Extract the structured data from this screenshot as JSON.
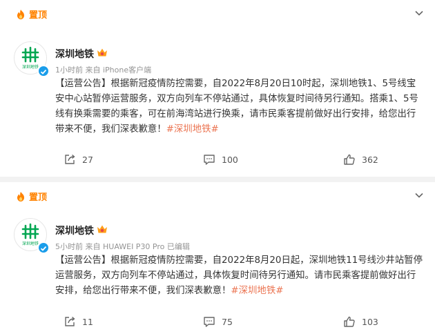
{
  "colors": {
    "accent": "#ff8200",
    "hashtag": "#eb7350",
    "verified": "#1a9dea",
    "logo": "#00a651"
  },
  "posts": [
    {
      "pin_label": "置顶",
      "author": "深圳地铁",
      "avatar_text": "深圳地铁",
      "meta": "1小时前 来自 iPhone客户端",
      "text": "【运营公告】根据新冠疫情防控需要，自2022年8月20日10时起，深圳地铁1、5号线宝安中心站暂停运营服务，双方向列车不停站通过，具体恢复时间待另行通知。搭乘1、5号线有换乘需要的乘客，可在前海湾站进行换乘，请市民乘客提前做好出行安排，给您出行带来不便，我们深表歉意！",
      "hashtag": "#深圳地铁#",
      "reposts": "27",
      "comments": "100",
      "likes": "362"
    },
    {
      "pin_label": "置顶",
      "author": "深圳地铁",
      "avatar_text": "深圳地铁",
      "meta": "5小时前 来自 HUAWEI P30 Pro 已编辑",
      "text": "【运营公告】根据新冠疫情防控需要，自2022年8月20日起，深圳地铁11号线沙井站暂停运营服务，双方向列车不停站通过，具体恢复时间待另行通知。请市民乘客提前做好出行安排，给您出行带来不便，我们深表歉意！",
      "hashtag": "#深圳地铁#",
      "reposts": "11",
      "comments": "75",
      "likes": "103"
    }
  ]
}
